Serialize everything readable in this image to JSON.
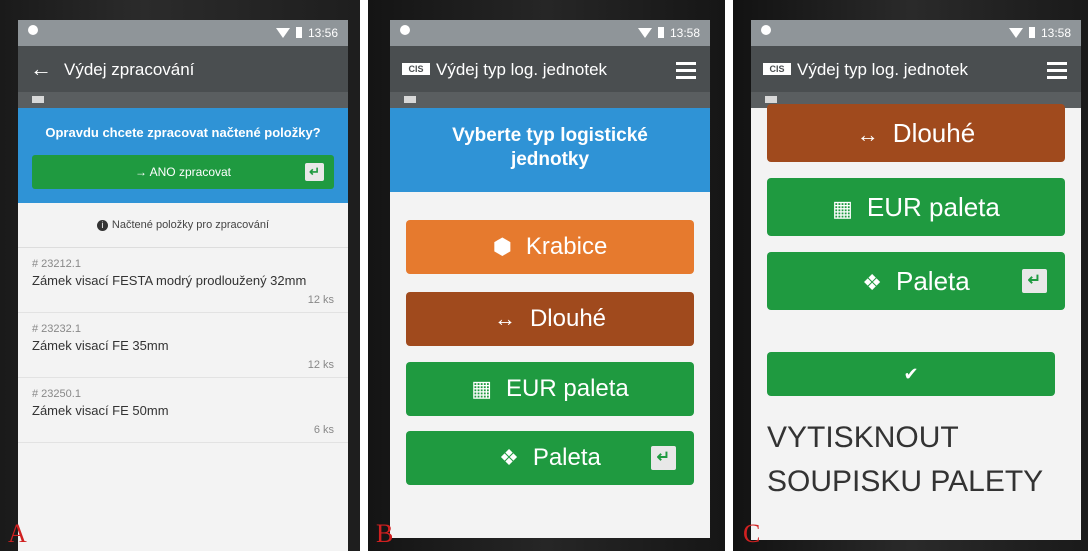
{
  "panels": [
    {
      "letter": "A",
      "time": "13:56",
      "title": "Výdej zpracování",
      "question": "Opravdu chcete zpracovat načtené položky?",
      "confirm_button": "ANO zpracovat",
      "list_header": "Načtené položky pro zpracování",
      "items": [
        {
          "code": "# 23212.1",
          "name": "Zámek visací FESTA modrý prodloužený 32mm",
          "qty": "12 ks"
        },
        {
          "code": "# 23232.1",
          "name": "Zámek visací FE 35mm",
          "qty": "12 ks"
        },
        {
          "code": "# 23250.1",
          "name": "Zámek visací FE 50mm",
          "qty": "6 ks"
        }
      ]
    },
    {
      "letter": "B",
      "time": "13:58",
      "title": "Výdej typ log. jednotek",
      "heading": "Vyberte typ logistické jednotky",
      "options": [
        {
          "label": "Krabice",
          "icon": "box-icon",
          "color": "#e67a2e"
        },
        {
          "label": "Dlouhé",
          "icon": "arrows-horizontal-icon",
          "color": "#a04a1d"
        },
        {
          "label": "EUR paleta",
          "icon": "pallet-icon",
          "color": "#1f9a40"
        },
        {
          "label": "Paleta",
          "icon": "boxes-icon",
          "color": "#1f9a40"
        }
      ]
    },
    {
      "letter": "C",
      "time": "13:58",
      "title": "Výdej typ log. jednotek",
      "options": [
        {
          "label": "Dlouhé",
          "icon": "arrows-horizontal-icon",
          "color": "#a04a1d"
        },
        {
          "label": "EUR paleta",
          "icon": "pallet-icon",
          "color": "#1f9a40"
        },
        {
          "label": "Paleta",
          "icon": "boxes-icon",
          "color": "#1f9a40"
        }
      ],
      "print_text": [
        "VYTISKNOUT",
        "SOUPISKU PALETY"
      ]
    }
  ],
  "logo_text": "CIS"
}
